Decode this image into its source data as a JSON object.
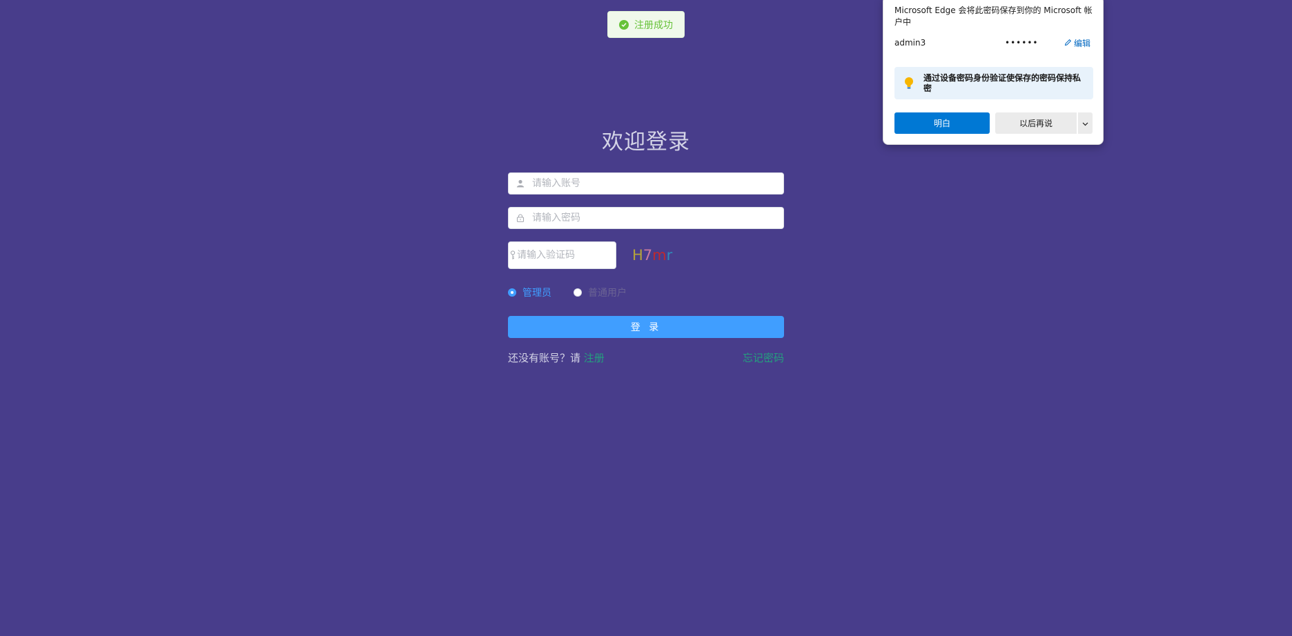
{
  "toast": {
    "message": "注册成功",
    "color": "#67c23a"
  },
  "login": {
    "title": "欢迎登录",
    "username_placeholder": "请输入账号",
    "password_placeholder": "请输入密码",
    "captcha_placeholder": "请输入验证码",
    "captcha": [
      {
        "ch": "H",
        "color": "#b5a43a"
      },
      {
        "ch": "7",
        "color": "#c97aa0"
      },
      {
        "ch": "m",
        "color": "#c0292e"
      },
      {
        "ch": "r",
        "color": "#2e8bb8"
      }
    ],
    "roles": [
      {
        "label": "管理员",
        "checked": true
      },
      {
        "label": "普通用户",
        "checked": false
      }
    ],
    "login_button": "登 录",
    "register_prompt": "还没有账号？请",
    "register_link": "注册",
    "forgot_link": "忘记密码"
  },
  "edge_popup": {
    "message": "Microsoft Edge 会将此密码保存到你的 Microsoft 帐户中",
    "username": "admin3",
    "password_mask": "••••••",
    "edit_label": "编辑",
    "tip": "通过设备密码身份验证使保存的密码保持私密",
    "ok_button": "明白",
    "later_button": "以后再说"
  },
  "colors": {
    "background": "#483d8b",
    "primary": "#409eff",
    "link": "#24a07e",
    "edge_accent": "#0078d4"
  }
}
